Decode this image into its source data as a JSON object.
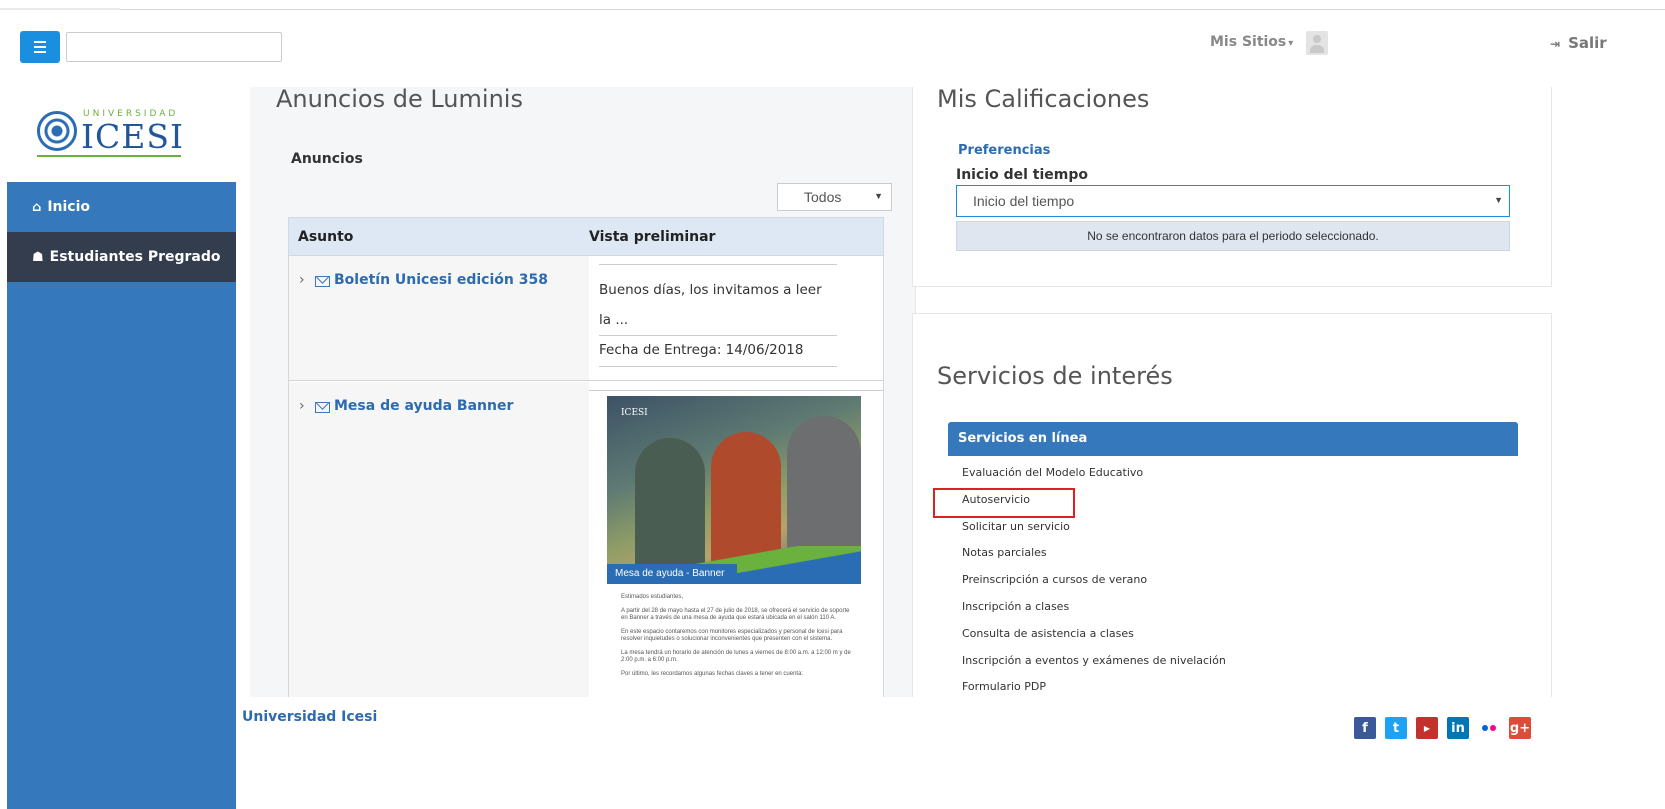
{
  "header": {
    "search_placeholder": "",
    "mis_sitios_label": "Mis Sitios",
    "salir_label": "Salir"
  },
  "sidebar": {
    "logo_top": "UNIVERSIDAD",
    "logo_name": "ICESI",
    "items": [
      {
        "label": "Inicio",
        "icon": "home-icon"
      },
      {
        "label": "Estudiantes Pregrado",
        "icon": "students-icon"
      }
    ]
  },
  "anuncios": {
    "title": "Anuncios de Luminis",
    "subtitle": "Anuncios",
    "filter_value": "Todos",
    "columns": [
      "Asunto",
      "Vista preliminar"
    ],
    "rows": [
      {
        "subject": "Boletín Unicesi edición 358",
        "preview_text": "Buenos días, los invitamos a leer la ...",
        "due": "Fecha de Entrega: 14/06/2018"
      },
      {
        "subject": "Mesa de ayuda Banner",
        "flyer": {
          "logo": "ICESI",
          "banner": "Mesa de ayuda - Banner",
          "paragraphs": [
            "Estimados estudiantes,",
            "A partir del 28 de mayo hasta el 27 de julio de 2018, se ofrecerá el servicio de soporte en Banner a través de una mesa de ayuda que estará ubicada en el salón 110 A.",
            "En este espacio contaremos con monitores especializados y personal de Icesi para resolver inquietudes o solucionar inconvenientes que presenten con el sistema.",
            "La mesa tendrá un horario de atención de lunes a viernes de 8:00 a.m. a 12:00 m y de 2:00 p.m. a 6:00 p.m.",
            "Por último, les recordamos algunas fechas claves a tener en cuenta:"
          ]
        }
      }
    ]
  },
  "calificaciones": {
    "title": "Mis Calificaciones",
    "preferences_link": "Preferencias",
    "period_label": "Inicio del tiempo",
    "period_value": "Inicio del tiempo",
    "empty_message": "No se encontraron datos para el periodo seleccionado."
  },
  "servicios": {
    "title": "Servicios de interés",
    "section_header": "Servicios en línea",
    "items": [
      "Evaluación del Modelo Educativo",
      "Autoservicio",
      "Solicitar un servicio",
      "Notas parciales",
      "Preinscripción a cursos de verano",
      "Inscripción a clases",
      "Consulta de asistencia a clases",
      "Inscripción a eventos y exámenes de nivelación",
      "Formulario PDP"
    ]
  },
  "footer": {
    "brand": "Universidad Icesi",
    "social": [
      "facebook-icon",
      "twitter-icon",
      "youtube-icon",
      "linkedin-icon",
      "flickr-icon",
      "google-plus-icon"
    ]
  }
}
